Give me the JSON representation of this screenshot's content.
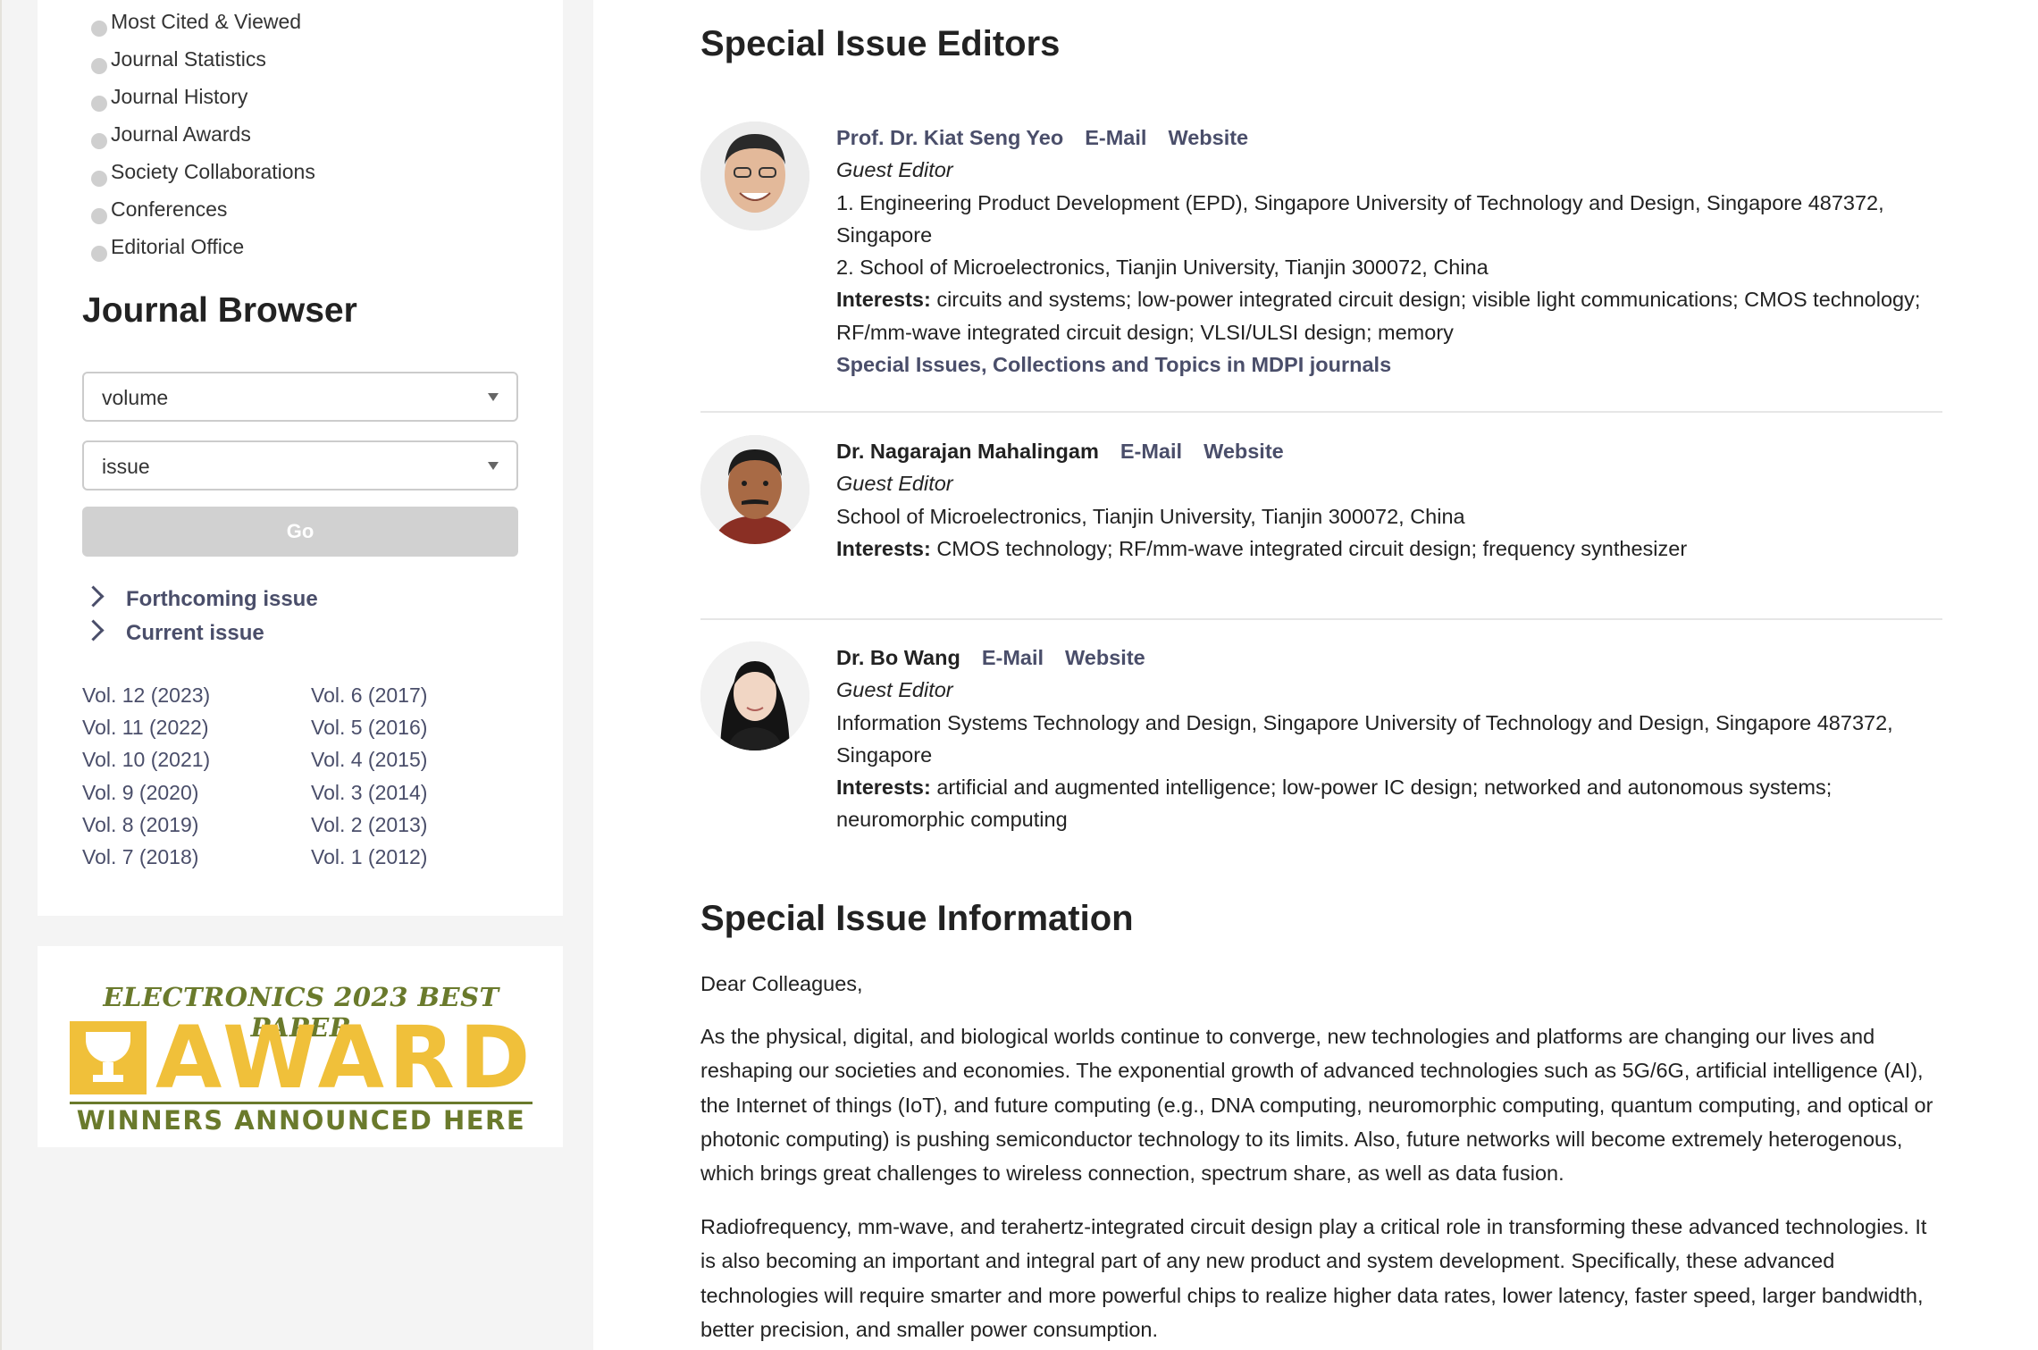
{
  "sidebar": {
    "nav_items": [
      "Most Cited & Viewed",
      "Journal Statistics",
      "Journal History",
      "Journal Awards",
      "Society Collaborations",
      "Conferences",
      "Editorial Office"
    ],
    "browser_title": "Journal Browser",
    "volume_select": "volume",
    "issue_select": "issue",
    "go_label": "Go",
    "forthcoming_label": "Forthcoming issue",
    "current_label": "Current issue",
    "volumes_left": [
      "Vol. 12 (2023)",
      "Vol. 11 (2022)",
      "Vol. 10 (2021)",
      "Vol. 9 (2020)",
      "Vol. 8 (2019)",
      "Vol. 7 (2018)"
    ],
    "volumes_right": [
      "Vol. 6 (2017)",
      "Vol. 5 (2016)",
      "Vol. 4 (2015)",
      "Vol. 3 (2014)",
      "Vol. 2 (2013)",
      "Vol. 1 (2012)"
    ],
    "award": {
      "top": "ELECTRONICS 2023 BEST PAPER",
      "main": "AWARD",
      "bottom": "WINNERS ANNOUNCED HERE",
      "colors": {
        "gold": "#f0c03a",
        "olive": "#6a7a2c"
      }
    }
  },
  "editors_title": "Special Issue Editors",
  "editors": [
    {
      "name": "Prof. Dr. Kiat Seng Yeo",
      "email_label": "E-Mail",
      "website_label": "Website",
      "role": "Guest Editor",
      "affiliation_1": "1. Engineering Product Development (EPD), Singapore University of Technology and Design, Singapore 487372, Singapore",
      "affiliation_2": "2. School of Microelectronics, Tianjin University, Tianjin 300072, China",
      "interests_label": "Interests:",
      "interests": "circuits and systems; low-power integrated circuit design; visible light communications; CMOS technology; RF/mm-wave integrated circuit design; VLSI/ULSI design; memory",
      "special_link": "Special Issues, Collections and Topics in MDPI journals"
    },
    {
      "name": "Dr. Nagarajan Mahalingam",
      "email_label": "E-Mail",
      "website_label": "Website",
      "role": "Guest Editor",
      "affiliation_1": "School of Microelectronics, Tianjin University, Tianjin 300072, China",
      "interests_label": "Interests:",
      "interests": "CMOS technology; RF/mm-wave integrated circuit design; frequency synthesizer"
    },
    {
      "name": "Dr. Bo Wang",
      "email_label": "E-Mail",
      "website_label": "Website",
      "role": "Guest Editor",
      "affiliation_1": "Information Systems Technology and Design, Singapore University of Technology and Design, Singapore 487372, Singapore",
      "interests_label": "Interests:",
      "interests": "artificial and augmented intelligence; low-power IC design; networked and autonomous systems; neuromorphic computing"
    }
  ],
  "info_title": "Special Issue Information",
  "info": {
    "greeting": "Dear Colleagues,",
    "paragraph_1": "As the physical, digital, and biological worlds continue to converge, new technologies and platforms are changing our lives and reshaping our societies and economies. The exponential growth of advanced technologies such as 5G/6G, artificial intelligence (AI), the Internet of things (IoT), and future computing (e.g., DNA computing, neuromorphic computing, quantum computing, and optical or photonic computing) is pushing semiconductor technology to its limits. Also, future networks will become extremely heterogenous, which brings great challenges to wireless connection, spectrum share, as well as data fusion.",
    "paragraph_2": "Radiofrequency, mm-wave, and terahertz-integrated circuit design play a critical role in transforming these advanced technologies. It is also becoming an important and integral part of any new product and system development. Specifically, these advanced technologies will require smarter and more powerful chips to realize higher data rates, lower latency, faster speed, larger bandwidth, better precision, and smaller power consumption."
  },
  "colors": {
    "link": "#4a4e6a",
    "text": "#222222",
    "sidebar_bg": "#f4f4f4"
  }
}
